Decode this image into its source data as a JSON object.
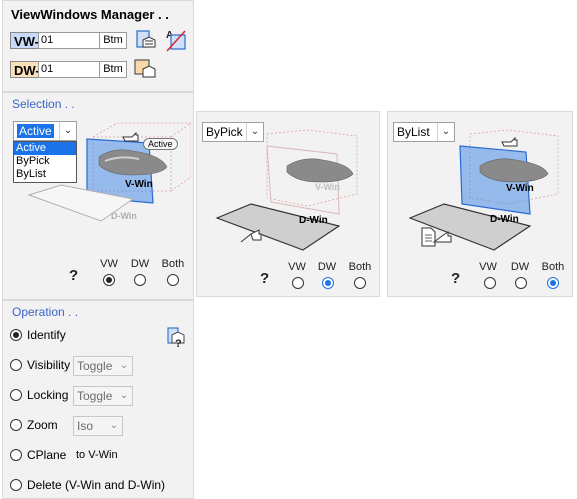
{
  "manager": {
    "title": "ViewWindows Manager . .",
    "vw_tag": "VW-",
    "vw_value": "01",
    "vw_btm": "Btm",
    "dw_tag": "DW-",
    "dw_value": "01",
    "dw_btm": "Btm"
  },
  "selection": {
    "title": "Selection . .",
    "combo_value": "Active",
    "dropdown_options": [
      "Active",
      "ByPick",
      "ByList"
    ],
    "active_callout": "Active",
    "vwin_label": "V-Win",
    "dwin_label": "D-Win",
    "help": "?",
    "radio_labels": [
      "VW",
      "DW",
      "Both"
    ],
    "selected": "VW"
  },
  "bypick": {
    "combo_value": "ByPick",
    "vwin_label": "V-Win",
    "dwin_label": "D-Win",
    "help": "?",
    "radio_labels": [
      "VW",
      "DW",
      "Both"
    ],
    "selected": "DW"
  },
  "bylist": {
    "combo_value": "ByList",
    "vwin_label": "V-Win",
    "dwin_label": "D-Win",
    "help": "?",
    "radio_labels": [
      "VW",
      "DW",
      "Both"
    ],
    "selected": "Both"
  },
  "operation": {
    "title": "Operation . .",
    "identify": "Identify",
    "visibility": "Visibility",
    "visibility_combo": "Toggle",
    "locking": "Locking",
    "locking_combo": "Toggle",
    "zoom": "Zoom",
    "zoom_combo": "Iso",
    "cplane": "CPlane",
    "cplane_note": "to V-Win",
    "delete": "Delete (V-Win and D-Win)",
    "selected": "Identify"
  },
  "colors": {
    "vw_tag_bg": "#c9daf8",
    "dw_tag_bg": "#f9e0b8",
    "accent_blue": "#1a73e8",
    "section_title": "#3a64c8"
  },
  "icons": [
    "vw-window-icon",
    "text-window-icon",
    "dw-window-icon",
    "help-icon",
    "hand-pointer-icon",
    "document-hand-icon",
    "operation-help-icon"
  ]
}
